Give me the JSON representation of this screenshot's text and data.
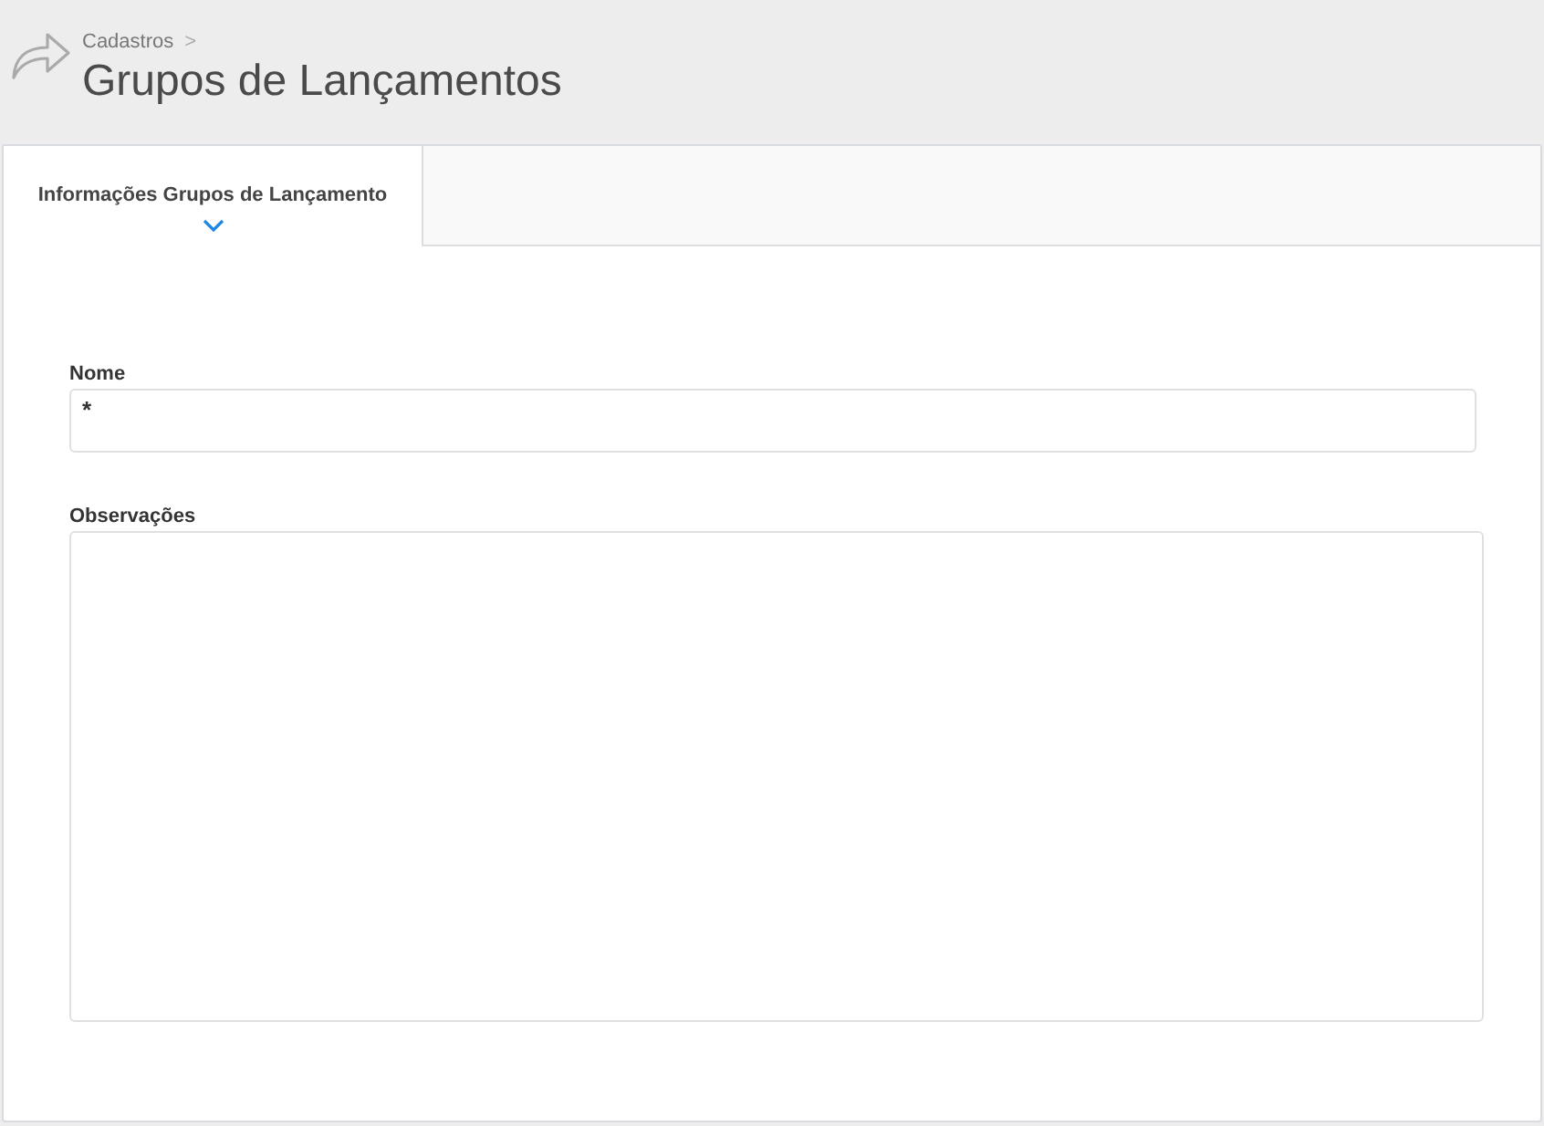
{
  "breadcrumb": {
    "items": [
      {
        "label": "Cadastros"
      }
    ],
    "separator": ">"
  },
  "page_title": "Grupos de Lançamentos",
  "tabs": [
    {
      "label": "Informações Grupos de Lançamento",
      "selected": true
    }
  ],
  "form": {
    "fields": [
      {
        "kind": "input",
        "label": "Nome",
        "value": "*"
      },
      {
        "kind": "textarea",
        "label": "Observações"
      }
    ]
  }
}
